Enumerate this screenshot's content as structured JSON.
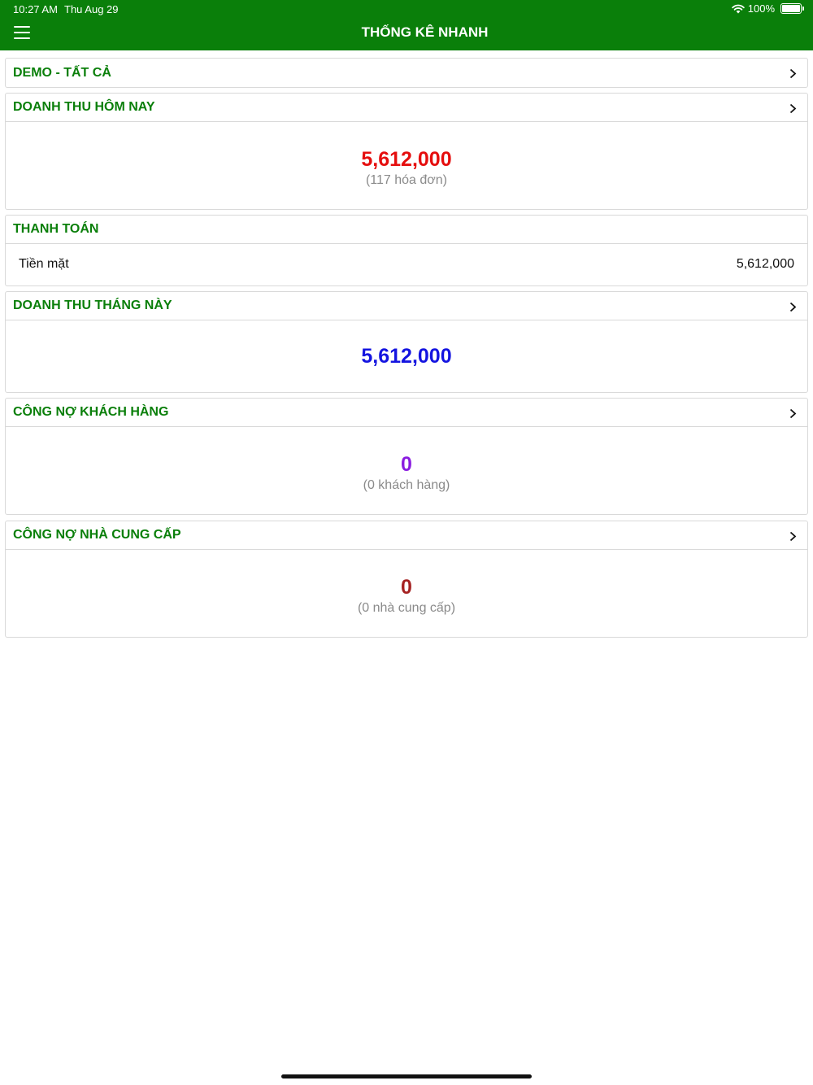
{
  "status_bar": {
    "time": "10:27 AM",
    "date": "Thu Aug 29",
    "battery": "100%"
  },
  "header": {
    "title": "THỐNG KÊ NHANH",
    "menu_icon": "hamburger-menu-icon"
  },
  "store": {
    "label": "DEMO - TẤT CẢ"
  },
  "today_revenue": {
    "label": "DOANH THU HÔM NAY",
    "value": "5,612,000",
    "invoices": "(117 hóa đơn)",
    "color": "#e50e0e"
  },
  "payment": {
    "label": "THANH TOÁN",
    "rows": [
      {
        "method": "Tiền mặt",
        "amount": "5,612,000"
      }
    ]
  },
  "month_revenue": {
    "label": "DOANH THU THÁNG NÀY",
    "value": "5,612,000",
    "color": "#1414e0"
  },
  "customer_debt": {
    "label": "CÔNG NỢ KHÁCH HÀNG",
    "value": "0",
    "count": "(0 khách hàng)",
    "color": "#8a1ce0"
  },
  "supplier_debt": {
    "label": "CÔNG NỢ NHÀ CUNG CẤP",
    "value": "0",
    "count": "(0 nhà cung cấp)",
    "color": "#a52222"
  },
  "colors": {
    "header_green": "#0a7f0a",
    "section_title": "#0a7f0a",
    "border": "#d9d9d9"
  }
}
